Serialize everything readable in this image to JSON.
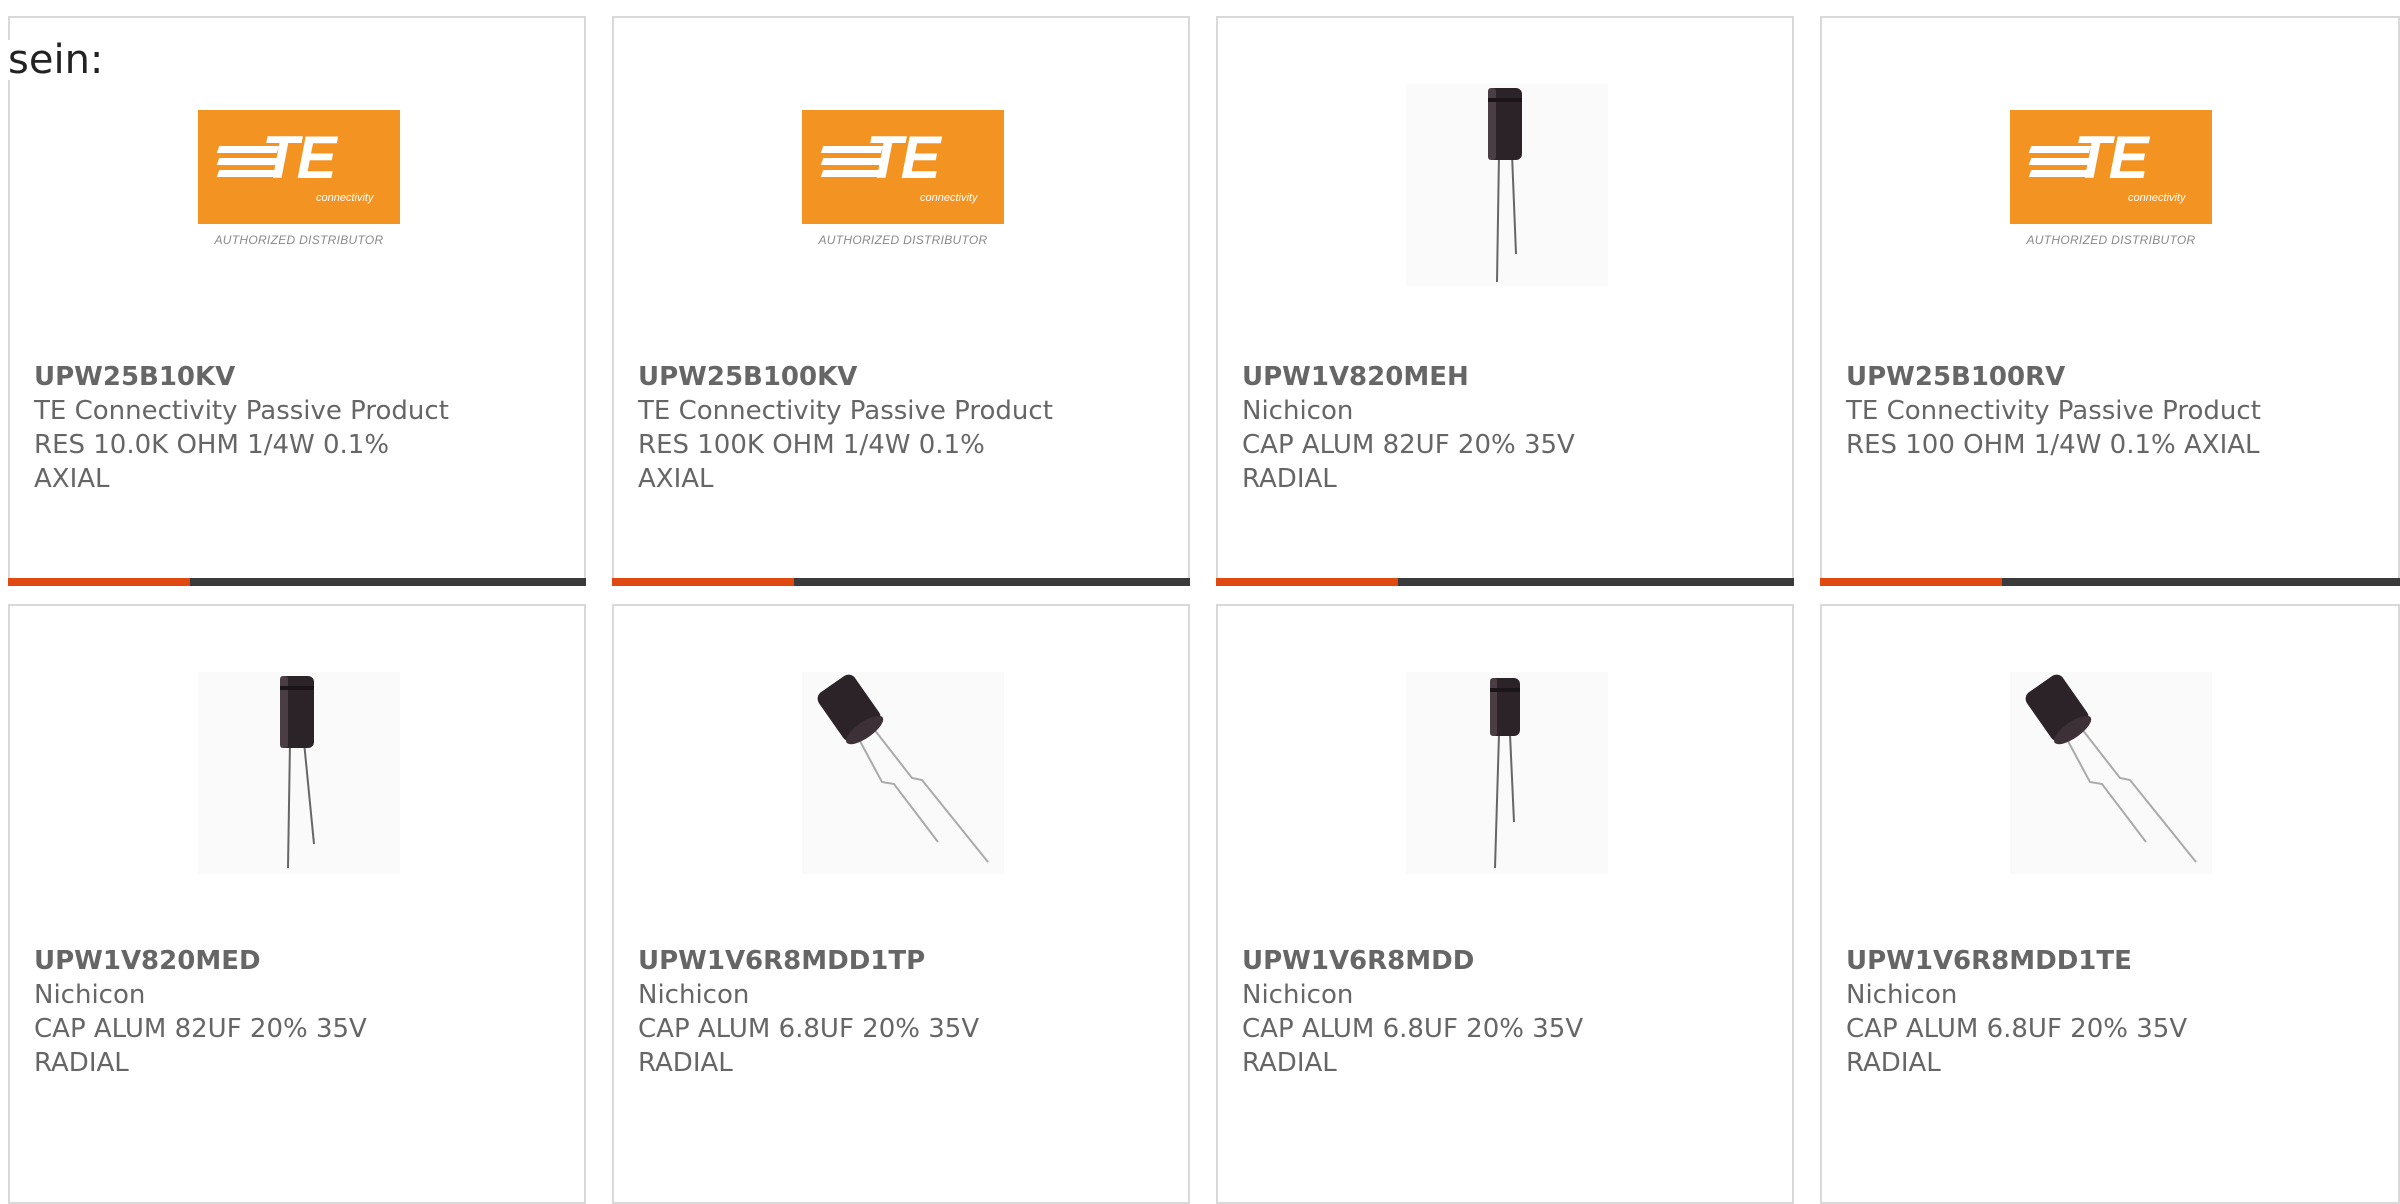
{
  "intro_text": "sein:",
  "colors": {
    "te_orange": "#f39322",
    "bar_accent": "#e04a12",
    "bar_dark": "#3a3a3a",
    "border": "#d9d9d9",
    "text": "#666666"
  },
  "products": [
    {
      "part_number": "UPW25B10KV",
      "manufacturer": "TE Connectivity Passive Product",
      "description_line1": "RES 10.0K OHM 1/4W 0.1%",
      "description_line2": "AXIAL",
      "image": "te-logo",
      "logo_text": "TE",
      "logo_sub": "connectivity",
      "logo_caption": "AUTHORIZED DISTRIBUTOR"
    },
    {
      "part_number": "UPW25B100KV",
      "manufacturer": "TE Connectivity Passive Product",
      "description_line1": "RES 100K OHM 1/4W 0.1%",
      "description_line2": "AXIAL",
      "image": "te-logo",
      "logo_text": "TE",
      "logo_sub": "connectivity",
      "logo_caption": "AUTHORIZED DISTRIBUTOR"
    },
    {
      "part_number": "UPW1V820MEH",
      "manufacturer": "Nichicon",
      "description_line1": "CAP ALUM 82UF 20% 35V",
      "description_line2": "RADIAL",
      "image": "capacitor-straight"
    },
    {
      "part_number": "UPW25B100RV",
      "manufacturer": "TE Connectivity Passive Product",
      "description_line1": "RES 100 OHM 1/4W 0.1% AXIAL",
      "description_line2": "",
      "image": "te-logo",
      "logo_text": "TE",
      "logo_sub": "connectivity",
      "logo_caption": "AUTHORIZED DISTRIBUTOR"
    },
    {
      "part_number": "UPW1V820MED",
      "manufacturer": "Nichicon",
      "description_line1": "CAP ALUM 82UF 20% 35V",
      "description_line2": "RADIAL",
      "image": "capacitor-straight"
    },
    {
      "part_number": "UPW1V6R8MDD1TP",
      "manufacturer": "Nichicon",
      "description_line1": "CAP ALUM 6.8UF 20% 35V",
      "description_line2": "RADIAL",
      "image": "capacitor-bent"
    },
    {
      "part_number": "UPW1V6R8MDD",
      "manufacturer": "Nichicon",
      "description_line1": "CAP ALUM 6.8UF 20% 35V",
      "description_line2": "RADIAL",
      "image": "capacitor-straight"
    },
    {
      "part_number": "UPW1V6R8MDD1TE",
      "manufacturer": "Nichicon",
      "description_line1": "CAP ALUM 6.8UF 20% 35V",
      "description_line2": "RADIAL",
      "image": "capacitor-bent"
    }
  ]
}
